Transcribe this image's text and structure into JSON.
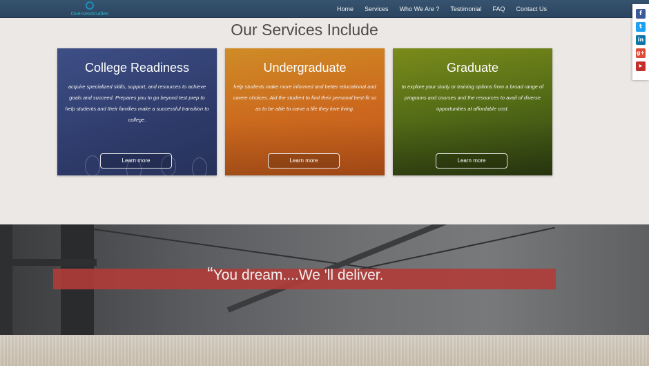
{
  "brand": {
    "logo_text": "OverseaStudies"
  },
  "nav": {
    "items": [
      "Home",
      "Services",
      "Who We Are ?",
      "Testimonial",
      "FAQ",
      "Contact Us"
    ]
  },
  "social": {
    "icons": [
      "facebook-icon",
      "twitter-icon",
      "linkedin-icon",
      "googleplus-icon",
      "youtube-icon"
    ]
  },
  "services": {
    "title": "Our Services Include",
    "cards": [
      {
        "title": "College Readiness",
        "text": "acquire specialized skills, support, and resources to achieve goals and succeed. Prepares you to go beyond test prep to help students and their families make a successful transition to college.",
        "button": "Learn more"
      },
      {
        "title": "Undergraduate",
        "text": "help students make more informed and better educational and career choices. Aid the student to find their personal best-fit so as to be able to carve a life they love living.",
        "button": "Learn more"
      },
      {
        "title": "Graduate",
        "text": "to explore your study or training options from a broad range of programs and courses and the resources to avail of diverse opportunities at affordable cost.",
        "button": "Learn more"
      }
    ]
  },
  "banner": {
    "quote_mark": "“",
    "quote": "You dream....We 'll deliver."
  },
  "colors": {
    "nav_bg": "#2f4a66",
    "quote_bar": "#b03c38",
    "card1": "#33406f",
    "card2": "#cc6a1e",
    "card3": "#516a16"
  }
}
